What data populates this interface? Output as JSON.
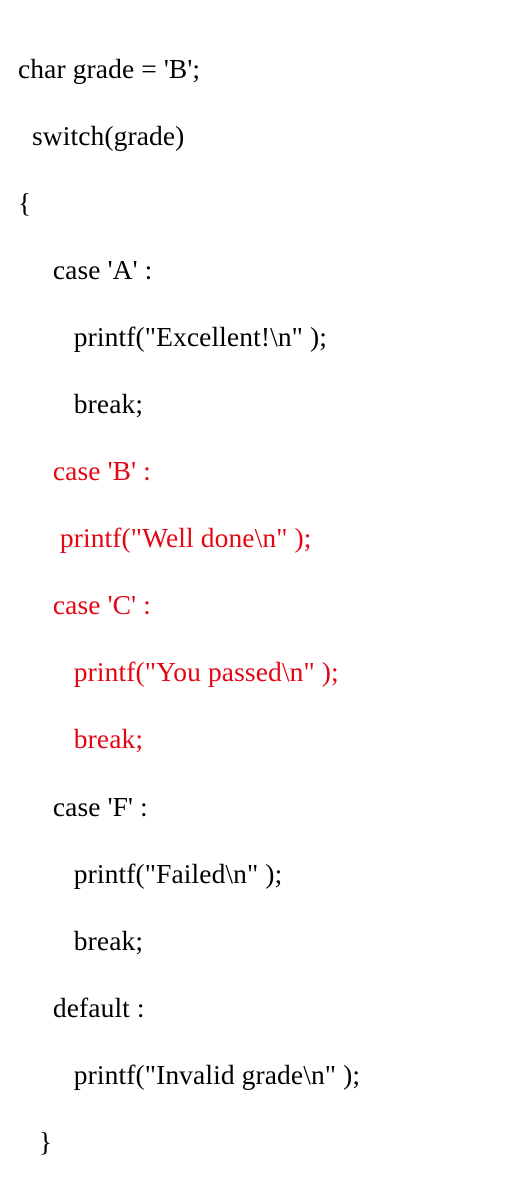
{
  "code": {
    "lines": [
      {
        "text": "char grade = 'B';",
        "color": "black"
      },
      {
        "text": "  switch(grade)",
        "color": "black"
      },
      {
        "text": "{",
        "color": "black"
      },
      {
        "text": "     case 'A' :",
        "color": "black"
      },
      {
        "text": "        printf(\"Excellent!\\n\" );",
        "color": "black"
      },
      {
        "text": "        break;",
        "color": "black"
      },
      {
        "text": "     case 'B' :",
        "color": "red"
      },
      {
        "text": "      printf(\"Well done\\n\" );",
        "color": "red"
      },
      {
        "text": "     case 'C' :",
        "color": "red"
      },
      {
        "text": "        printf(\"You passed\\n\" );",
        "color": "red"
      },
      {
        "text": "        break;",
        "color": "red"
      },
      {
        "text": "     case 'F' :",
        "color": "black"
      },
      {
        "text": "        printf(\"Failed\\n\" );",
        "color": "black"
      },
      {
        "text": "        break;",
        "color": "black"
      },
      {
        "text": "     default :",
        "color": "black"
      },
      {
        "text": "        printf(\"Invalid grade\\n\" );",
        "color": "black"
      },
      {
        "text": "   }",
        "color": "black"
      }
    ]
  }
}
